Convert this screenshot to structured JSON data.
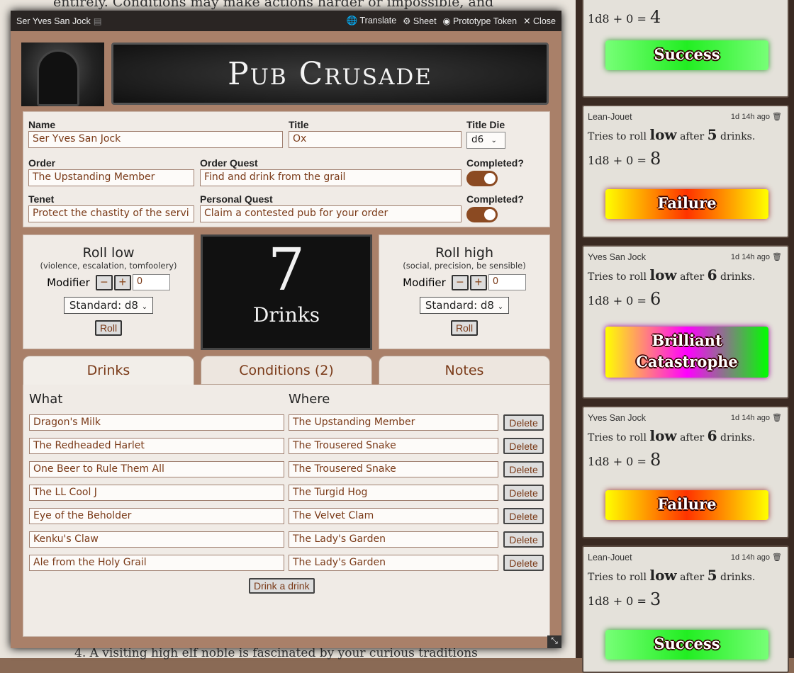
{
  "background": {
    "top_text": "entirely. Conditions may make actions harder or impossible, and",
    "bottom_text": "4. A visiting high elf noble is fascinated by your curious traditions"
  },
  "window": {
    "title": "Ser Yves San Jock",
    "actions": {
      "translate": "Translate",
      "sheet": "Sheet",
      "prototype": "Prototype Token",
      "close": "Close"
    }
  },
  "banner": "Pub Crusade",
  "form": {
    "name_label": "Name",
    "name": "Ser Yves San Jock",
    "title_label": "Title",
    "title": "Ox",
    "titledie_label": "Title Die",
    "titledie": "d6",
    "order_label": "Order",
    "order": "The Upstanding Member",
    "orderquest_label": "Order Quest",
    "orderquest": "Find and drink from the grail",
    "completed_label": "Completed?",
    "order_completed": true,
    "tenet_label": "Tenet",
    "tenet": "Protect the chastity of the servi",
    "personal_label": "Personal Quest",
    "personal": "Claim a contested pub for your order",
    "personal_completed": true
  },
  "roll_low": {
    "title": "Roll low",
    "sub": "(violence, escalation, tomfoolery)",
    "modifier_label": "Modifier",
    "modifier": "0",
    "die": "Standard: d8",
    "button": "Roll"
  },
  "roll_high": {
    "title": "Roll high",
    "sub": "(social, precision, be sensible)",
    "modifier_label": "Modifier",
    "modifier": "0",
    "die": "Standard: d8",
    "button": "Roll"
  },
  "drinks_count": {
    "number": "7",
    "label": "Drinks"
  },
  "tabs": [
    "Drinks",
    "Conditions (2)",
    "Notes"
  ],
  "drinks_table": {
    "what": "What",
    "where": "Where",
    "delete": "Delete",
    "add": "Drink a drink",
    "rows": [
      {
        "what": "Dragon's Milk",
        "where": "The Upstanding Member"
      },
      {
        "what": "The Redheaded Harlet",
        "where": "The Trousered Snake"
      },
      {
        "what": "One Beer to Rule Them All",
        "where": "The Trousered Snake"
      },
      {
        "what": "The LL Cool J",
        "where": "The Turgid Hog"
      },
      {
        "what": "Eye of the Beholder",
        "where": "The Velvet Clam"
      },
      {
        "what": "Kenku's Claw",
        "where": "The Lady's Garden"
      },
      {
        "what": "Ale from the Holy Grail",
        "where": "The Lady's Garden"
      }
    ]
  },
  "chat": [
    {
      "who": "",
      "ago": "",
      "pre": "",
      "dir": "",
      "mid": "",
      "n": "",
      "post": "",
      "eq": "1d8 + 0 = ",
      "total": "4",
      "result": "Success",
      "kind": "succ"
    },
    {
      "who": "Lean-Jouet",
      "ago": "1d 14h ago",
      "pre": "Tries to roll ",
      "dir": "low",
      "mid": " after ",
      "n": "5",
      "post": " drinks.",
      "eq": "1d8 + 0 = ",
      "total": "8",
      "result": "Failure",
      "kind": "fail"
    },
    {
      "who": "Yves San Jock",
      "ago": "1d 14h ago",
      "pre": "Tries to roll ",
      "dir": "low",
      "mid": " after ",
      "n": "6",
      "post": " drinks.",
      "eq": "1d8 + 0 = ",
      "total": "6",
      "result": "Brilliant Catastrophe",
      "kind": "brill"
    },
    {
      "who": "Yves San Jock",
      "ago": "1d 14h ago",
      "pre": "Tries to roll ",
      "dir": "low",
      "mid": " after ",
      "n": "6",
      "post": " drinks.",
      "eq": "1d8 + 0 = ",
      "total": "8",
      "result": "Failure",
      "kind": "fail"
    },
    {
      "who": "Lean-Jouet",
      "ago": "1d 14h ago",
      "pre": "Tries to roll ",
      "dir": "low",
      "mid": " after ",
      "n": "5",
      "post": " drinks.",
      "eq": "1d8 + 0 = ",
      "total": "3",
      "result": "Success",
      "kind": "succ"
    }
  ]
}
